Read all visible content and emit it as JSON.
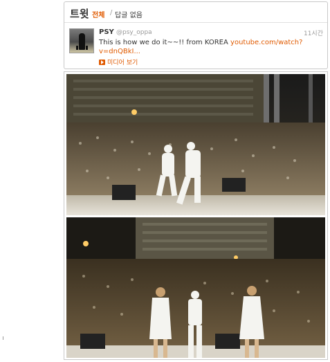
{
  "header": {
    "title": "트윗",
    "filter_all": "전체",
    "filter_separator": "/",
    "filter_no_replies": "답글 없음"
  },
  "tweet": {
    "name": "PSY",
    "handle": "@psy_oppa",
    "time": "11시간",
    "text": "This is how we do it~~!! from KOREA ",
    "link": "youtube.com/watch?v=dnQBkI...",
    "media_toggle": "미디어 보기"
  },
  "colors": {
    "accent": "#e05a00",
    "text": "#333333",
    "muted": "#999999",
    "border": "#c8c8c8"
  }
}
